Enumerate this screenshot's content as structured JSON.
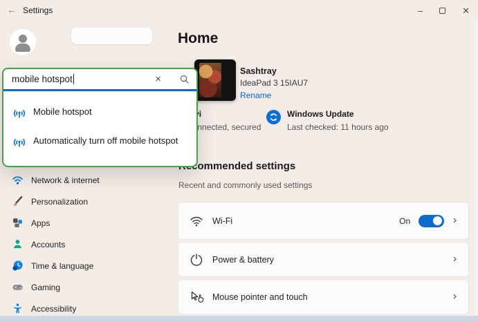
{
  "titlebar": {
    "title": "Settings",
    "back_glyph": "←",
    "minimize_glyph": "–",
    "close_glyph": "✕"
  },
  "search": {
    "value": "mobile hotspot",
    "clear_glyph": "×",
    "results": [
      {
        "label": "Mobile hotspot"
      },
      {
        "label": "Automatically turn off mobile hotspot"
      }
    ]
  },
  "sidebar": {
    "items": [
      {
        "label": "Network & internet",
        "icon": "wifi-icon"
      },
      {
        "label": "Personalization",
        "icon": "paintbrush-icon"
      },
      {
        "label": "Apps",
        "icon": "apps-grid-icon"
      },
      {
        "label": "Accounts",
        "icon": "person-icon"
      },
      {
        "label": "Time & language",
        "icon": "clock-globe-icon"
      },
      {
        "label": "Gaming",
        "icon": "gamepad-icon"
      },
      {
        "label": "Accessibility",
        "icon": "accessibility-person-icon"
      }
    ]
  },
  "main": {
    "heading": "Home",
    "device": {
      "name": "Sashtray",
      "model": "IdeaPad 3 15IAU7",
      "rename_label": "Rename"
    },
    "status": {
      "wifi_name": "Vivi",
      "wifi_status": "Connected, secured",
      "update_title": "Windows Update",
      "update_status": "Last checked: 11 hours ago"
    },
    "recommended": {
      "title": "Recommended settings",
      "subtitle": "Recent and commonly used settings",
      "rows": [
        {
          "label": "Wi-Fi",
          "toggle_state": "On",
          "chevron": "›"
        },
        {
          "label": "Power & battery",
          "chevron": "›"
        },
        {
          "label": "Mouse pointer and touch",
          "chevron": "›"
        }
      ]
    }
  },
  "colors": {
    "accent_blue": "#0a6ace",
    "highlight_green": "#44a248",
    "window_bg": "#f3ece7",
    "card_bg": "#fbfbfb",
    "bottom_strip": "#cbd6e4"
  }
}
